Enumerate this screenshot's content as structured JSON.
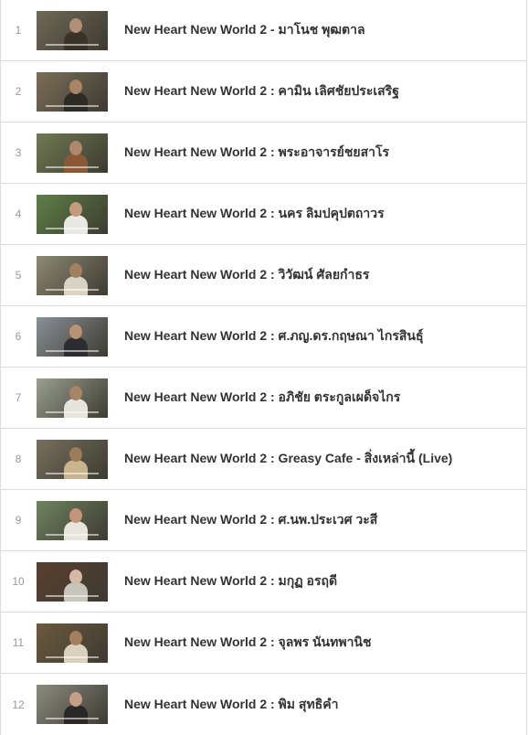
{
  "playlist": [
    {
      "index": "1",
      "title": "New Heart New World 2 - มาโนช พุฒตาล",
      "thumb_bg": "#6d6a58",
      "thumb_fg": "#3a3327",
      "thumb_head": "#b48f77"
    },
    {
      "index": "2",
      "title": "New Heart New World 2 : คามิน เลิศชัยประเสริฐ",
      "thumb_bg": "#7a6f58",
      "thumb_fg": "#2c2a25",
      "thumb_head": "#a98466"
    },
    {
      "index": "3",
      "title": "New Heart New World 2 : พระอาจารย์ชยสาโร",
      "thumb_bg": "#6f7b52",
      "thumb_fg": "#8a5a36",
      "thumb_head": "#b0876a"
    },
    {
      "index": "4",
      "title": "New Heart New World 2 : นคร ลิมปคุปตถาวร",
      "thumb_bg": "#5e8046",
      "thumb_fg": "#e9e9e4",
      "thumb_head": "#c49a7c"
    },
    {
      "index": "5",
      "title": "New Heart New World 2 : วิวัฒน์ ศัลยกำธร",
      "thumb_bg": "#8c8a73",
      "thumb_fg": "#d7d4c6",
      "thumb_head": "#a2805f"
    },
    {
      "index": "6",
      "title": "New Heart New World 2 : ศ.ภญ.ดร.กฤษณา ไกรสินธุ์",
      "thumb_bg": "#8a9097",
      "thumb_fg": "#2b2d30",
      "thumb_head": "#b79273"
    },
    {
      "index": "7",
      "title": "New Heart New World 2 : อภิชัย ตระกูลเผด็จไกร",
      "thumb_bg": "#9aa092",
      "thumb_fg": "#e6e4dc",
      "thumb_head": "#a68568"
    },
    {
      "index": "8",
      "title": "New Heart New World 2 : Greasy Cafe - สิ่งเหล่านี้ (Live)",
      "thumb_bg": "#76705c",
      "thumb_fg": "#c9b48d",
      "thumb_head": "#9c7a5c"
    },
    {
      "index": "9",
      "title": "New Heart New World 2 : ศ.นพ.ประเวศ วะสี",
      "thumb_bg": "#6f8360",
      "thumb_fg": "#e8e5dd",
      "thumb_head": "#c2947a"
    },
    {
      "index": "10",
      "title": "New Heart New World 2 : มกุฏ อรฤดี",
      "thumb_bg": "#5a3f30",
      "thumb_fg": "#c7c4bc",
      "thumb_head": "#d6b9a3"
    },
    {
      "index": "11",
      "title": "New Heart New World 2 : จุลพร นันทพานิช",
      "thumb_bg": "#6b5a3d",
      "thumb_fg": "#d9d1bd",
      "thumb_head": "#a47e5d"
    },
    {
      "index": "12",
      "title": "New Heart New World 2 : พิม สุทธิคำ",
      "thumb_bg": "#8c8b80",
      "thumb_fg": "#2a2826",
      "thumb_head": "#c39f86"
    }
  ]
}
